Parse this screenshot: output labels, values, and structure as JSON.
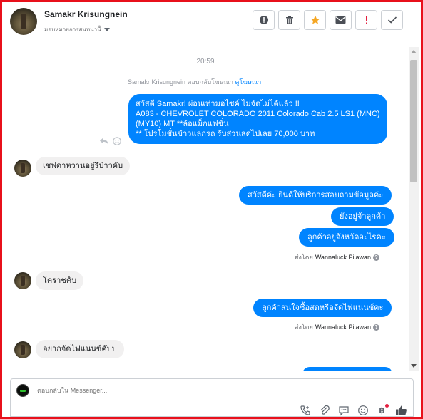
{
  "header": {
    "contact_name": "Samakr Krisungnein",
    "assign_label": "มอบหมายการสนทนานี้"
  },
  "actions": [
    {
      "name": "spam-button",
      "icon": "alert-icon"
    },
    {
      "name": "delete-button",
      "icon": "trash-icon"
    },
    {
      "name": "star-button",
      "icon": "star-icon"
    },
    {
      "name": "unread-button",
      "icon": "envelope-icon"
    },
    {
      "name": "follow-up-button",
      "icon": "exclamation-icon"
    },
    {
      "name": "done-button",
      "icon": "check-icon"
    }
  ],
  "chat": {
    "timestamp": "20:59",
    "ad_note": "Samakr Krisungnein ตอบกลับโฆษณา",
    "ad_link": "ดูโฆษณา",
    "messages": {
      "m1_line1": "สวัสดี Samakr! ผ่อนเท่ามอไซค์ ไม่จัดไม่ได้แล้ว !!",
      "m1_line2": "A083 - CHEVROLET COLORADO 2011 Colorado Cab 2.5 LS1 (MNC)",
      "m1_line3": "(MY10) MT **ล้อแม็กแฟชั่น",
      "m1_line4": "** โปรโมชั่นข้าวแลกรถ รับส่วนลดไปเลย 70,000 บาท",
      "m2": "เชฟดาหวานอยู่รึป่าวคับ",
      "m3": "สวัสดีค่ะ  ยินดีให้บริการสอบถามข้อมูลค่ะ",
      "m4": "ยังอยู่จ้าลูกค้า",
      "m5": "ลูกค้าอยู่จังหวัดอะไรคะ",
      "m6": "โคราชคับ",
      "m7": "ลูกค้าสนใจซื้อสดหรือจัดไฟแนนซ์คะ",
      "m8": "อยากจัดไฟแนนซ์คับบ"
    },
    "sent_by_prefix": "ส่งโดย",
    "sent_by_name": "Wannaluck Pilawan"
  },
  "composer": {
    "placeholder": "ตอบกลับใน Messenger..."
  },
  "colors": {
    "accent": "#0084ff",
    "border_frame": "#e8101b",
    "star": "#f5a623",
    "exclamation": "#e41e3f"
  }
}
